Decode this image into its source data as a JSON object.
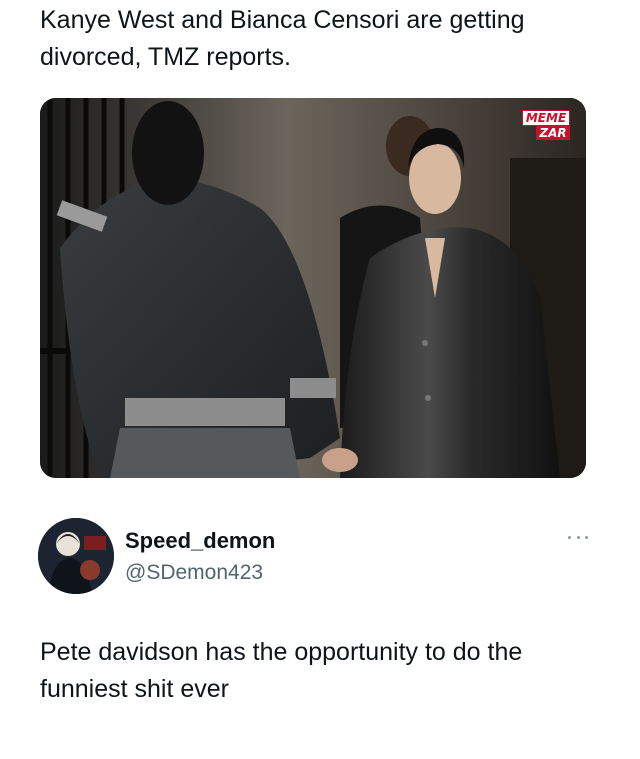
{
  "post": {
    "headline": "Kanye West and Bianca Censori are getting divorced, TMZ reports.",
    "watermark": {
      "top": "MEME",
      "bottom": "ZAR"
    }
  },
  "tweet": {
    "display_name": "Speed_demon",
    "handle": "@SDemon423",
    "more_icon": "ellipsis-icon",
    "text": "Pete davidson has the opportunity to do the funniest shit ever"
  },
  "colors": {
    "text_primary": "#0f1419",
    "text_secondary": "#536471",
    "watermark_red": "#c8102e"
  }
}
